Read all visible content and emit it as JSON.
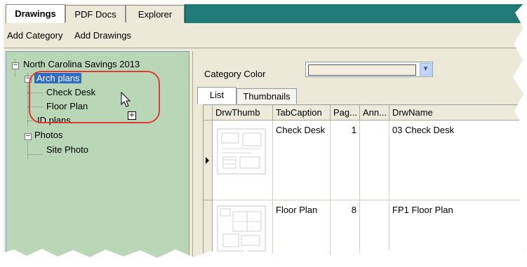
{
  "main_tabs": [
    {
      "label": "Drawings",
      "active": true
    },
    {
      "label": "PDF Docs",
      "active": false
    },
    {
      "label": "Explorer",
      "active": false
    }
  ],
  "toolbar": {
    "add_category": "Add Category",
    "add_drawings": "Add Drawings"
  },
  "tree": {
    "root": "North Carolina Savings 2013",
    "arch_plans": "Arch plans",
    "check_desk": "Check Desk",
    "floor_plan": "Floor Plan",
    "id_plans": "ID plans",
    "photos": "Photos",
    "site_photo": "Site Photo",
    "background_color": "#b9d7b6",
    "selected_color": "#316ac5",
    "highlight_color": "#e03b34"
  },
  "category_color": {
    "label": "Category Color"
  },
  "inner_tabs": [
    {
      "label": "List",
      "active": true
    },
    {
      "label": "Thumbnails",
      "active": false
    }
  ],
  "grid": {
    "columns": [
      "DrwThumb",
      "TabCaption",
      "Pag...",
      "Ann...",
      "DrwName"
    ],
    "rows": [
      {
        "caption": "Check Desk",
        "page": "1",
        "ann": "",
        "name": "03 Check Desk"
      },
      {
        "caption": "Floor Plan",
        "page": "8",
        "ann": "",
        "name": "FP1 Floor Plan"
      }
    ]
  },
  "colors": {
    "tab_strip_fill": "#1f7a78"
  }
}
